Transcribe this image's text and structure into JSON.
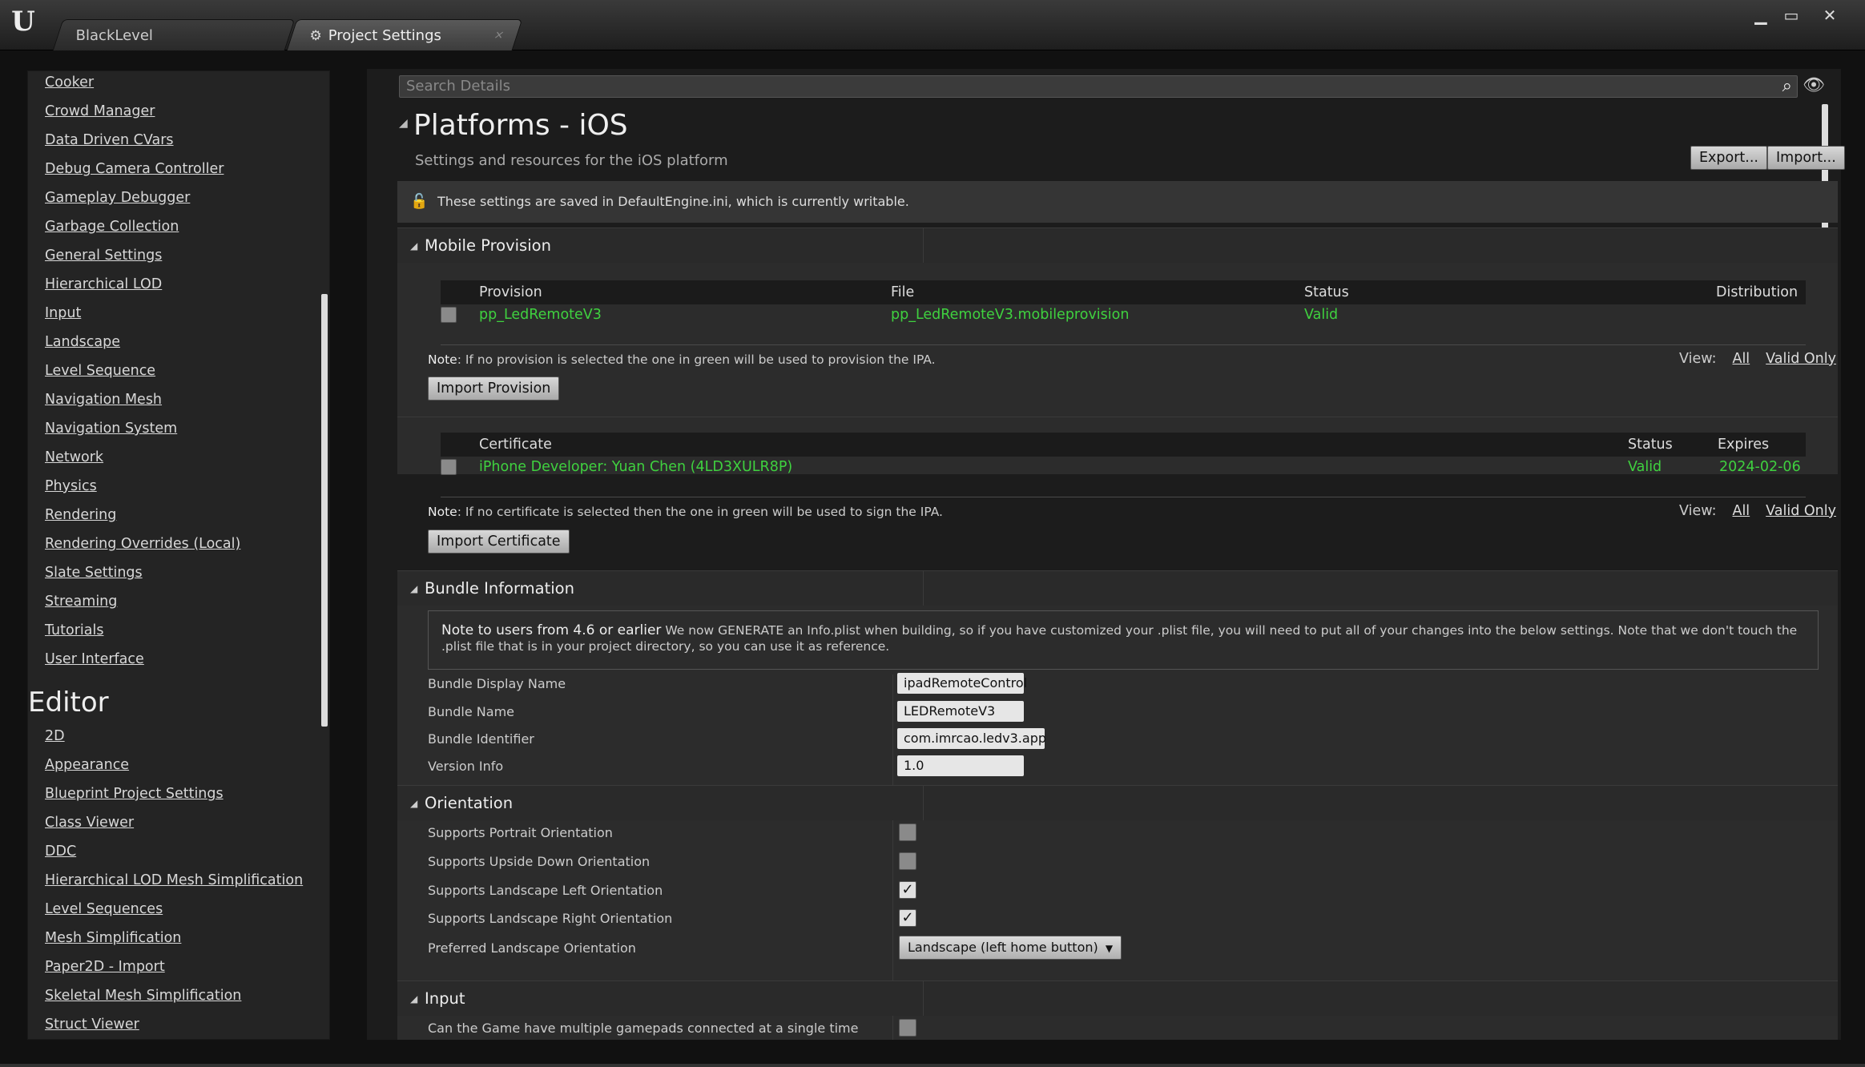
{
  "window": {
    "tabs": [
      {
        "label": "BlackLevel"
      },
      {
        "label": "Project Settings"
      }
    ],
    "close_glyph": "×",
    "controls": {
      "minimize": "▁",
      "maximize": "▭",
      "close": "✕"
    }
  },
  "sidebar": {
    "items_top": [
      "Cooker",
      "Crowd Manager",
      "Data Driven CVars",
      "Debug Camera Controller",
      "Gameplay Debugger",
      "Garbage Collection",
      "General Settings",
      "Hierarchical LOD",
      "Input",
      "Landscape",
      "Level Sequence",
      "Navigation Mesh",
      "Navigation System",
      "Network",
      "Physics",
      "Rendering",
      "Rendering Overrides (Local)",
      "Slate Settings",
      "Streaming",
      "Tutorials",
      "User Interface"
    ],
    "editor_heading": "Editor",
    "items_editor": [
      "2D",
      "Appearance",
      "Blueprint Project Settings",
      "Class Viewer",
      "DDC",
      "Hierarchical LOD Mesh Simplification",
      "Level Sequences",
      "Mesh Simplification",
      "Paper2D - Import",
      "Skeletal Mesh Simplification",
      "Struct Viewer"
    ]
  },
  "details": {
    "search_placeholder": "Search Details",
    "title": "Platforms - iOS",
    "subtitle": "Settings and resources for the iOS platform",
    "export_label": "Export...",
    "import_label": "Import...",
    "writable_info": "These settings are saved in DefaultEngine.ini, which is currently writable."
  },
  "mobile_provision": {
    "header": "Mobile Provision",
    "provision_columns": [
      "Provision",
      "File",
      "Status",
      "Distribution"
    ],
    "provision_row": {
      "provision": "pp_LedRemoteV3",
      "file": "pp_LedRemoteV3.mobileprovision",
      "status": "Valid"
    },
    "provision_note_bold": "Note",
    "provision_note": ": If no provision is selected the one in green will be used to provision the IPA.",
    "view_label": "View:",
    "view_all": "All",
    "view_valid_only": "Valid Only",
    "import_provision": "Import Provision",
    "certificate_columns": [
      "Certificate",
      "Status",
      "Expires"
    ],
    "certificate_row": {
      "certificate": "iPhone Developer: Yuan Chen (4LD3XULR8P)",
      "status": "Valid",
      "expires": "2024-02-06"
    },
    "certificate_note_bold": "Note",
    "certificate_note": ": If no certificate is selected then the one in green will be used to sign the IPA.",
    "import_certificate": "Import Certificate"
  },
  "bundle_information": {
    "header": "Bundle Information",
    "note_bold": "Note to users from 4.6 or earlier",
    "note_text": " We now GENERATE an Info.plist when building, so if you have customized your .plist file, you will need to put all of your changes into the below settings. Note that we don't touch the .plist file that is in your project directory, so you can use it as reference.",
    "fields": [
      {
        "label": "Bundle Display Name",
        "value": "ipadRemoteControl"
      },
      {
        "label": "Bundle Name",
        "value": "LEDRemoteV3"
      },
      {
        "label": "Bundle Identifier",
        "value": "com.imrcao.ledv3.app"
      },
      {
        "label": "Version Info",
        "value": "1.0"
      }
    ]
  },
  "orientation": {
    "header": "Orientation",
    "options": [
      {
        "label": "Supports Portrait Orientation",
        "checked": false
      },
      {
        "label": "Supports Upside Down Orientation",
        "checked": false
      },
      {
        "label": "Supports Landscape Left Orientation",
        "checked": true
      },
      {
        "label": "Supports Landscape Right Orientation",
        "checked": true
      }
    ],
    "preferred_label": "Preferred Landscape Orientation",
    "preferred_value": "Landscape (left home button)"
  },
  "input": {
    "header": "Input",
    "gamepads_label": "Can the Game have multiple gamepads connected at a single time",
    "gamepads_checked": false
  },
  "glyphs": {
    "check": "✓",
    "dropdown_arrow": "▼",
    "collapse_arrow": "◢",
    "search": "⌕",
    "eye": "👁",
    "lock": "🔓",
    "gear": "⚙"
  }
}
